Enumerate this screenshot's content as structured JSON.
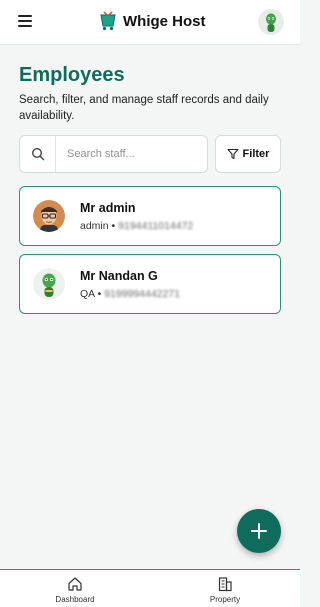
{
  "app": {
    "brand_name": "Whige Host"
  },
  "header": {
    "title": "Employees",
    "subtitle": "Search, filter, and manage staff records and daily availability."
  },
  "search": {
    "placeholder": "Search staff...",
    "value": ""
  },
  "filter": {
    "label": "Filter"
  },
  "employees": [
    {
      "name": "Mr admin",
      "role": "admin",
      "separator": "•",
      "phone": "9194411014472"
    },
    {
      "name": "Mr Nandan G",
      "role": "QA",
      "separator": "•",
      "phone": "9199994442271"
    }
  ],
  "bottom_nav": [
    {
      "label": "Dashboard",
      "icon": "home-icon"
    },
    {
      "label": "Property",
      "icon": "building-icon"
    }
  ],
  "colors": {
    "accent": "#0f6b5b",
    "card_border": "#2f8f78",
    "background": "#f4f6f5"
  }
}
